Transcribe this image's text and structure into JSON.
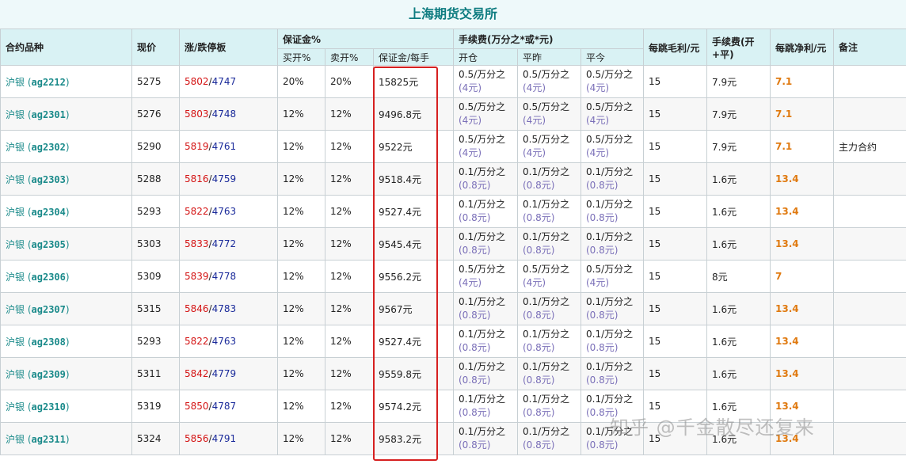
{
  "title": "上海期货交易所",
  "headers": {
    "contract": "合约品种",
    "price": "现价",
    "limit": "涨/跌停板",
    "margin_group": "保证金%",
    "margin_buy": "买开%",
    "margin_sell": "卖开%",
    "margin_per_lot": "保证金/每手",
    "fee_group": "手续费(万分之*或*元)",
    "fee_open": "开仓",
    "fee_close_yesterday": "平昨",
    "fee_close_today": "平今",
    "tick_gross": "每跳毛利/元",
    "fee_round": "手续费(开+平)",
    "tick_net": "每跳净利/元",
    "note": "备注"
  },
  "rows": [
    {
      "name": "沪银",
      "code": "ag2212",
      "price": "5275",
      "up": "5802",
      "down": "4747",
      "buy": "20%",
      "sell": "20%",
      "margin": "15825元",
      "fee_open": "0.5/万分之",
      "fee_open_sub": "(4元)",
      "fee_cy": "0.5/万分之",
      "fee_cy_sub": "(4元)",
      "fee_ct": "0.5/万分之",
      "fee_ct_sub": "(4元)",
      "gross": "15",
      "round": "7.9元",
      "net": "7.1",
      "note": ""
    },
    {
      "name": "沪银",
      "code": "ag2301",
      "price": "5276",
      "up": "5803",
      "down": "4748",
      "buy": "12%",
      "sell": "12%",
      "margin": "9496.8元",
      "fee_open": "0.5/万分之",
      "fee_open_sub": "(4元)",
      "fee_cy": "0.5/万分之",
      "fee_cy_sub": "(4元)",
      "fee_ct": "0.5/万分之",
      "fee_ct_sub": "(4元)",
      "gross": "15",
      "round": "7.9元",
      "net": "7.1",
      "note": ""
    },
    {
      "name": "沪银",
      "code": "ag2302",
      "price": "5290",
      "up": "5819",
      "down": "4761",
      "buy": "12%",
      "sell": "12%",
      "margin": "9522元",
      "fee_open": "0.5/万分之",
      "fee_open_sub": "(4元)",
      "fee_cy": "0.5/万分之",
      "fee_cy_sub": "(4元)",
      "fee_ct": "0.5/万分之",
      "fee_ct_sub": "(4元)",
      "gross": "15",
      "round": "7.9元",
      "net": "7.1",
      "note": "主力合约"
    },
    {
      "name": "沪银",
      "code": "ag2303",
      "price": "5288",
      "up": "5816",
      "down": "4759",
      "buy": "12%",
      "sell": "12%",
      "margin": "9518.4元",
      "fee_open": "0.1/万分之",
      "fee_open_sub": "(0.8元)",
      "fee_cy": "0.1/万分之",
      "fee_cy_sub": "(0.8元)",
      "fee_ct": "0.1/万分之",
      "fee_ct_sub": "(0.8元)",
      "gross": "15",
      "round": "1.6元",
      "net": "13.4",
      "note": ""
    },
    {
      "name": "沪银",
      "code": "ag2304",
      "price": "5293",
      "up": "5822",
      "down": "4763",
      "buy": "12%",
      "sell": "12%",
      "margin": "9527.4元",
      "fee_open": "0.1/万分之",
      "fee_open_sub": "(0.8元)",
      "fee_cy": "0.1/万分之",
      "fee_cy_sub": "(0.8元)",
      "fee_ct": "0.1/万分之",
      "fee_ct_sub": "(0.8元)",
      "gross": "15",
      "round": "1.6元",
      "net": "13.4",
      "note": ""
    },
    {
      "name": "沪银",
      "code": "ag2305",
      "price": "5303",
      "up": "5833",
      "down": "4772",
      "buy": "12%",
      "sell": "12%",
      "margin": "9545.4元",
      "fee_open": "0.1/万分之",
      "fee_open_sub": "(0.8元)",
      "fee_cy": "0.1/万分之",
      "fee_cy_sub": "(0.8元)",
      "fee_ct": "0.1/万分之",
      "fee_ct_sub": "(0.8元)",
      "gross": "15",
      "round": "1.6元",
      "net": "13.4",
      "note": ""
    },
    {
      "name": "沪银",
      "code": "ag2306",
      "price": "5309",
      "up": "5839",
      "down": "4778",
      "buy": "12%",
      "sell": "12%",
      "margin": "9556.2元",
      "fee_open": "0.5/万分之",
      "fee_open_sub": "(4元)",
      "fee_cy": "0.5/万分之",
      "fee_cy_sub": "(4元)",
      "fee_ct": "0.5/万分之",
      "fee_ct_sub": "(4元)",
      "gross": "15",
      "round": "8元",
      "net": "7",
      "note": ""
    },
    {
      "name": "沪银",
      "code": "ag2307",
      "price": "5315",
      "up": "5846",
      "down": "4783",
      "buy": "12%",
      "sell": "12%",
      "margin": "9567元",
      "fee_open": "0.1/万分之",
      "fee_open_sub": "(0.8元)",
      "fee_cy": "0.1/万分之",
      "fee_cy_sub": "(0.8元)",
      "fee_ct": "0.1/万分之",
      "fee_ct_sub": "(0.8元)",
      "gross": "15",
      "round": "1.6元",
      "net": "13.4",
      "note": ""
    },
    {
      "name": "沪银",
      "code": "ag2308",
      "price": "5293",
      "up": "5822",
      "down": "4763",
      "buy": "12%",
      "sell": "12%",
      "margin": "9527.4元",
      "fee_open": "0.1/万分之",
      "fee_open_sub": "(0.8元)",
      "fee_cy": "0.1/万分之",
      "fee_cy_sub": "(0.8元)",
      "fee_ct": "0.1/万分之",
      "fee_ct_sub": "(0.8元)",
      "gross": "15",
      "round": "1.6元",
      "net": "13.4",
      "note": ""
    },
    {
      "name": "沪银",
      "code": "ag2309",
      "price": "5311",
      "up": "5842",
      "down": "4779",
      "buy": "12%",
      "sell": "12%",
      "margin": "9559.8元",
      "fee_open": "0.1/万分之",
      "fee_open_sub": "(0.8元)",
      "fee_cy": "0.1/万分之",
      "fee_cy_sub": "(0.8元)",
      "fee_ct": "0.1/万分之",
      "fee_ct_sub": "(0.8元)",
      "gross": "15",
      "round": "1.6元",
      "net": "13.4",
      "note": ""
    },
    {
      "name": "沪银",
      "code": "ag2310",
      "price": "5319",
      "up": "5850",
      "down": "4787",
      "buy": "12%",
      "sell": "12%",
      "margin": "9574.2元",
      "fee_open": "0.1/万分之",
      "fee_open_sub": "(0.8元)",
      "fee_cy": "0.1/万分之",
      "fee_cy_sub": "(0.8元)",
      "fee_ct": "0.1/万分之",
      "fee_ct_sub": "(0.8元)",
      "gross": "15",
      "round": "1.6元",
      "net": "13.4",
      "note": ""
    },
    {
      "name": "沪银",
      "code": "ag2311",
      "price": "5324",
      "up": "5856",
      "down": "4791",
      "buy": "12%",
      "sell": "12%",
      "margin": "9583.2元",
      "fee_open": "0.1/万分之",
      "fee_open_sub": "(0.8元)",
      "fee_cy": "0.1/万分之",
      "fee_cy_sub": "(0.8元)",
      "fee_ct": "0.1/万分之",
      "fee_ct_sub": "(0.8元)",
      "gross": "15",
      "round": "1.6元",
      "net": "13.4",
      "note": ""
    }
  ],
  "watermark": "知乎 @千金散尽还复来",
  "colors": {
    "title": "#0e7c80",
    "header_bg": "#d9f2f4",
    "limit_up": "#d41414",
    "limit_down": "#1a2a9a",
    "net": "#e07a10",
    "highlight": "#d62020"
  }
}
